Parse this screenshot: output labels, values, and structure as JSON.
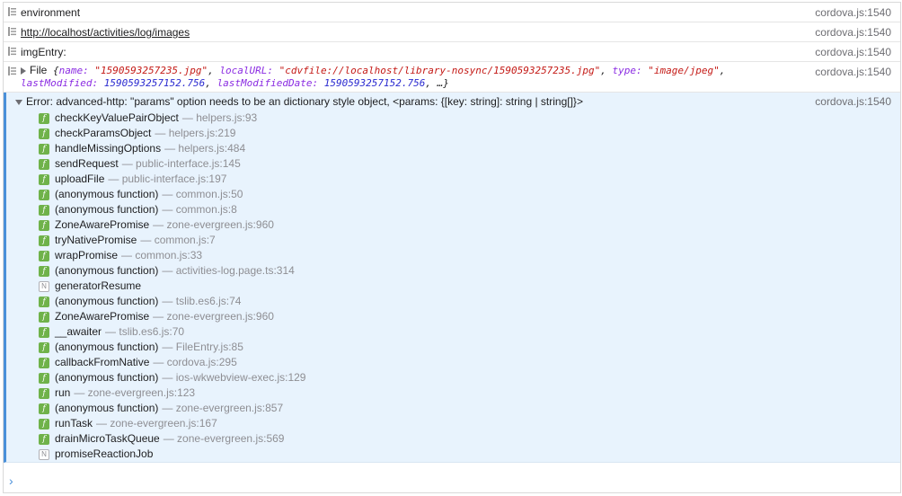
{
  "console": {
    "entries": [
      {
        "text": "environment",
        "source": "cordova.js:1540"
      },
      {
        "text": "http://localhost/activities/log/images",
        "source": "cordova.js:1540"
      },
      {
        "text": "imgEntry:",
        "source": "cordova.js:1540"
      }
    ],
    "file_entry": {
      "prefix": "File",
      "name_key": "name:",
      "name_val": "\"1590593257235.jpg\"",
      "localurl_key": "localURL:",
      "localurl_val": "\"cdvfile://localhost/library-nosync/1590593257235.jpg\"",
      "type_key": "type:",
      "type_val": "\"image/jpeg\"",
      "lastmod_key": "lastModified:",
      "lastmod_val": "1590593257152.756",
      "lastmoddate_key": "lastModifiedDate:",
      "lastmoddate_val": "1590593257152.756",
      "ellipsis": "…}",
      "source": "cordova.js:1540"
    },
    "error": {
      "message": "Error: advanced-http: \"params\" option needs to be an dictionary style object, <params: {[key: string]: string | string[]}>",
      "source": "cordova.js:1540",
      "frames": [
        {
          "badge": "f",
          "fn": "checkKeyValuePairObject",
          "loc": "— helpers.js:93"
        },
        {
          "badge": "f",
          "fn": "checkParamsObject",
          "loc": "— helpers.js:219"
        },
        {
          "badge": "f",
          "fn": "handleMissingOptions",
          "loc": "— helpers.js:484"
        },
        {
          "badge": "f",
          "fn": "sendRequest",
          "loc": "— public-interface.js:145"
        },
        {
          "badge": "f",
          "fn": "uploadFile",
          "loc": "— public-interface.js:197"
        },
        {
          "badge": "f",
          "fn": "(anonymous function)",
          "loc": "— common.js:50"
        },
        {
          "badge": "f",
          "fn": "(anonymous function)",
          "loc": "— common.js:8"
        },
        {
          "badge": "f",
          "fn": "ZoneAwarePromise",
          "loc": "— zone-evergreen.js:960"
        },
        {
          "badge": "f",
          "fn": "tryNativePromise",
          "loc": "— common.js:7"
        },
        {
          "badge": "f",
          "fn": "wrapPromise",
          "loc": "— common.js:33"
        },
        {
          "badge": "f",
          "fn": "(anonymous function)",
          "loc": "— activities-log.page.ts:314"
        },
        {
          "badge": "N",
          "fn": "generatorResume",
          "loc": ""
        },
        {
          "badge": "f",
          "fn": "(anonymous function)",
          "loc": "— tslib.es6.js:74"
        },
        {
          "badge": "f",
          "fn": "ZoneAwarePromise",
          "loc": "— zone-evergreen.js:960"
        },
        {
          "badge": "f",
          "fn": "__awaiter",
          "loc": "— tslib.es6.js:70"
        },
        {
          "badge": "f",
          "fn": "(anonymous function)",
          "loc": "— FileEntry.js:85"
        },
        {
          "badge": "f",
          "fn": "callbackFromNative",
          "loc": "— cordova.js:295"
        },
        {
          "badge": "f",
          "fn": "(anonymous function)",
          "loc": "— ios-wkwebview-exec.js:129"
        },
        {
          "badge": "f",
          "fn": "run",
          "loc": "— zone-evergreen.js:123"
        },
        {
          "badge": "f",
          "fn": "(anonymous function)",
          "loc": "— zone-evergreen.js:857"
        },
        {
          "badge": "f",
          "fn": "runTask",
          "loc": "— zone-evergreen.js:167"
        },
        {
          "badge": "f",
          "fn": "drainMicroTaskQueue",
          "loc": "— zone-evergreen.js:569"
        },
        {
          "badge": "N",
          "fn": "promiseReactionJob",
          "loc": ""
        }
      ]
    },
    "prompt": {
      "value": ""
    },
    "colors": {
      "error_bg": "#e8f3fd",
      "accent": "#4a90d9",
      "function_badge": "#6fb24a"
    }
  }
}
